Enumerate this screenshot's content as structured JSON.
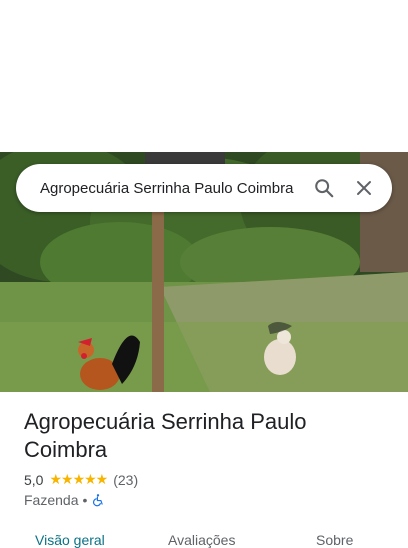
{
  "search": {
    "query": "Agropecuária Serrinha Paulo Coimbra"
  },
  "place": {
    "name": "Agropecuária Serrinha Paulo Coimbra",
    "rating": "5,0",
    "stars": "★★★★★",
    "reviews_count": "(23)",
    "category": "Fazenda",
    "separator": "•"
  },
  "tabs": [
    {
      "label": "Visão geral",
      "active": true
    },
    {
      "label": "Avaliações",
      "active": false
    },
    {
      "label": "Sobre",
      "active": false
    }
  ],
  "colors": {
    "accent": "#0b7285",
    "star": "#f7b400",
    "accessibility": "#1a73e8"
  },
  "icons": {
    "search": "search-icon",
    "close": "close-icon",
    "accessibility": "wheelchair-icon"
  }
}
